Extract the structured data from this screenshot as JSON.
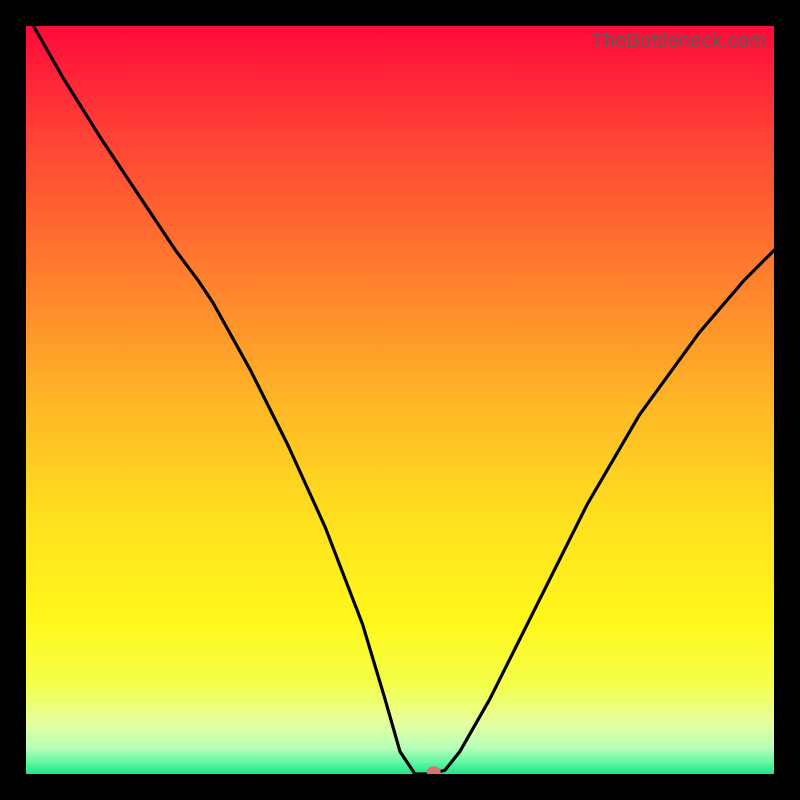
{
  "watermark": "TheBottleneck.com",
  "chart_data": {
    "type": "line",
    "title": "",
    "xlabel": "",
    "ylabel": "",
    "xlim": [
      0,
      100
    ],
    "ylim": [
      0,
      100
    ],
    "grid": false,
    "legend": false,
    "gradient_stops": [
      {
        "offset": 0.0,
        "color": "#ff0a3a"
      },
      {
        "offset": 0.14,
        "color": "#ff3f36"
      },
      {
        "offset": 0.32,
        "color": "#ff7a2e"
      },
      {
        "offset": 0.5,
        "color": "#ffb526"
      },
      {
        "offset": 0.66,
        "color": "#ffe11f"
      },
      {
        "offset": 0.8,
        "color": "#fff81c"
      },
      {
        "offset": 0.88,
        "color": "#f4ff4a"
      },
      {
        "offset": 0.93,
        "color": "#e6ff9d"
      },
      {
        "offset": 0.965,
        "color": "#b8ffb8"
      },
      {
        "offset": 0.985,
        "color": "#5ef7a0"
      },
      {
        "offset": 1.0,
        "color": "#1de58b"
      }
    ],
    "series": [
      {
        "name": "bottleneck-curve",
        "x": [
          1.0,
          5.0,
          10.0,
          15.0,
          20.0,
          23.0,
          25.0,
          30.0,
          35.0,
          40.0,
          45.0,
          48.0,
          50.0,
          52.0,
          54.0,
          56.0,
          58.0,
          62.0,
          68.0,
          75.0,
          82.0,
          90.0,
          96.0,
          100.0
        ],
        "y": [
          100.0,
          93.0,
          85.0,
          77.5,
          70.0,
          66.0,
          63.0,
          54.0,
          44.0,
          33.0,
          20.0,
          10.0,
          3.0,
          0.0,
          0.0,
          0.5,
          3.0,
          10.0,
          22.0,
          36.0,
          48.0,
          59.0,
          66.0,
          70.0
        ]
      }
    ],
    "marker": {
      "x": 54.5,
      "y": 0.3,
      "color": "#d9716f"
    }
  }
}
